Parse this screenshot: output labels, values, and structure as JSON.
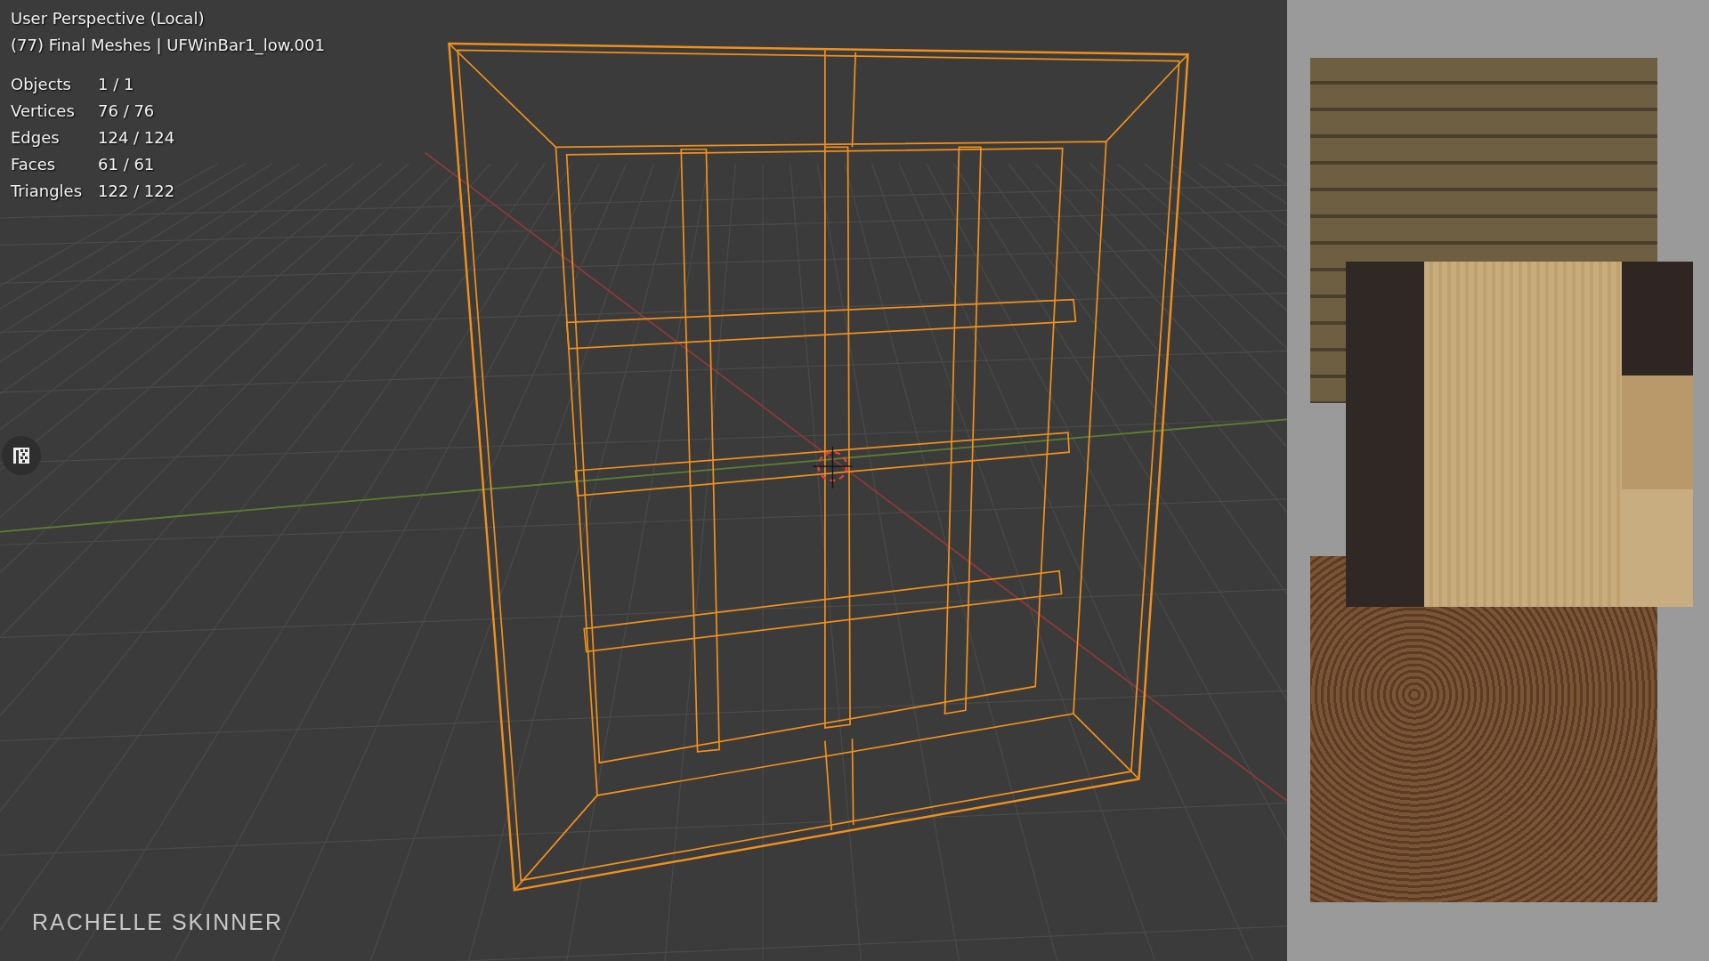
{
  "viewport": {
    "view_title": "User Perspective (Local)",
    "object_info": "(77) Final Meshes | UFWinBar1_low.001",
    "stats": [
      {
        "label": "Objects",
        "value": "1 / 1"
      },
      {
        "label": "Vertices",
        "value": "76 / 76"
      },
      {
        "label": "Edges",
        "value": "124 / 124"
      },
      {
        "label": "Faces",
        "value": "61 / 61"
      },
      {
        "label": "Triangles",
        "value": "122 / 122"
      }
    ],
    "signature": "RACHELLE SKINNER"
  }
}
